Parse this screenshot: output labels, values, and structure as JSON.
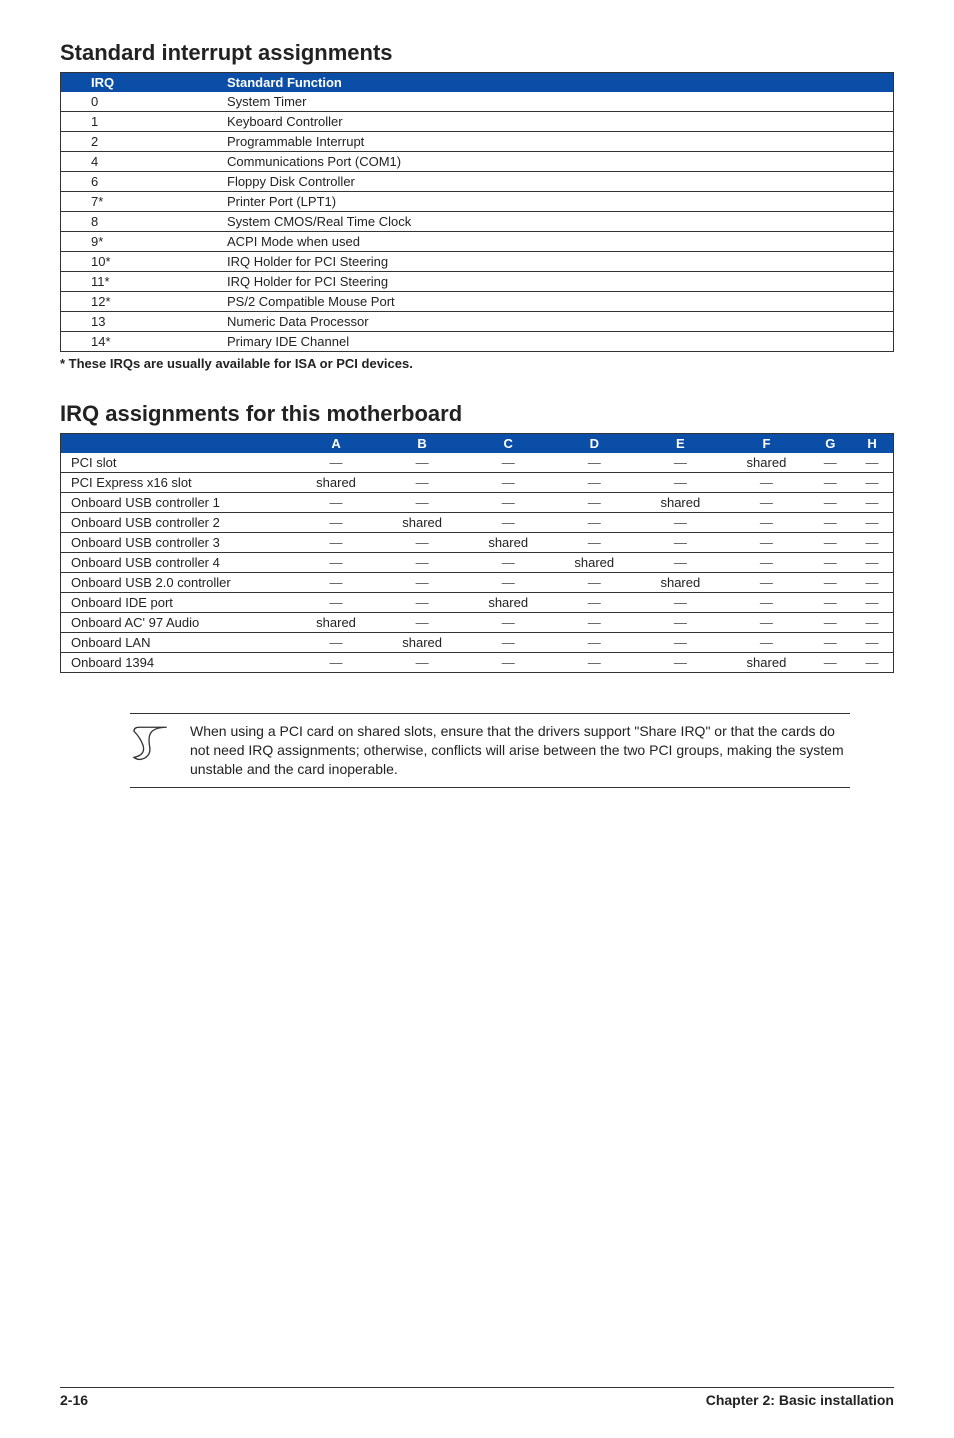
{
  "section1": {
    "title": "Standard interrupt assignments",
    "headers": {
      "irq": "IRQ",
      "func": "Standard Function"
    },
    "rows": [
      {
        "irq": "0",
        "func": "System Timer"
      },
      {
        "irq": "1",
        "func": "Keyboard Controller"
      },
      {
        "irq": "2",
        "func": "Programmable Interrupt"
      },
      {
        "irq": "4",
        "func": "Communications Port (COM1)"
      },
      {
        "irq": "6",
        "func": "Floppy Disk Controller"
      },
      {
        "irq": "7*",
        "func": "Printer Port (LPT1)"
      },
      {
        "irq": "8",
        "func": "System CMOS/Real Time Clock"
      },
      {
        "irq": "9*",
        "func": "ACPI Mode when used"
      },
      {
        "irq": "10*",
        "func": "IRQ Holder for PCI Steering"
      },
      {
        "irq": "11*",
        "func": "IRQ Holder for PCI Steering"
      },
      {
        "irq": "12*",
        "func": "PS/2 Compatible Mouse Port"
      },
      {
        "irq": "13",
        "func": "Numeric Data Processor"
      },
      {
        "irq": "14*",
        "func": "Primary IDE Channel"
      }
    ],
    "footnote": "* These IRQs are usually available for ISA or PCI devices."
  },
  "section2": {
    "title": "IRQ assignments for this motherboard",
    "cols": [
      "A",
      "B",
      "C",
      "D",
      "E",
      "F",
      "G",
      "H"
    ],
    "dash": "—",
    "shared": "shared",
    "rows": [
      {
        "name": "PCI slot",
        "cells": [
          "—",
          "—",
          "—",
          "—",
          "—",
          "shared",
          "—",
          "—"
        ]
      },
      {
        "name": "PCI Express x16 slot",
        "cells": [
          "shared",
          "—",
          "—",
          "—",
          "—",
          "—",
          "—",
          "—"
        ]
      },
      {
        "name": "Onboard USB controller 1",
        "cells": [
          "—",
          "—",
          "—",
          "—",
          "shared",
          "—",
          "—",
          "—"
        ]
      },
      {
        "name": "Onboard USB controller 2",
        "cells": [
          "—",
          "shared",
          "—",
          "—",
          "—",
          "—",
          "—",
          "—"
        ]
      },
      {
        "name": "Onboard USB controller 3",
        "cells": [
          "—",
          "—",
          "shared",
          "—",
          "—",
          "—",
          "—",
          "—"
        ]
      },
      {
        "name": "Onboard USB controller 4",
        "cells": [
          "—",
          "—",
          "—",
          "shared",
          "—",
          "—",
          "—",
          "—"
        ]
      },
      {
        "name": "Onboard USB 2.0 controller",
        "cells": [
          "—",
          "—",
          "—",
          "—",
          "shared",
          "—",
          "—",
          "—"
        ]
      },
      {
        "name": "Onboard IDE port",
        "cells": [
          "—",
          "—",
          "shared",
          "—",
          "—",
          "—",
          "—",
          "—"
        ]
      },
      {
        "name": "Onboard AC' 97 Audio",
        "cells": [
          "shared",
          "—",
          "—",
          "—",
          "—",
          "—",
          "—",
          "—"
        ]
      },
      {
        "name": "Onboard LAN",
        "cells": [
          "—",
          "shared",
          "—",
          "—",
          "—",
          "—",
          "—",
          "—"
        ]
      },
      {
        "name": "Onboard 1394",
        "cells": [
          "—",
          "—",
          "—",
          "—",
          "—",
          "shared",
          "—",
          "—"
        ]
      }
    ]
  },
  "note": "When using a PCI card on shared slots, ensure that the drivers support \"Share IRQ\" or that the cards do not need IRQ assignments; otherwise, conflicts will arise between the two PCI groups, making the system unstable and the card inoperable.",
  "footer": {
    "page": "2-16",
    "chapter": "Chapter 2: Basic installation"
  }
}
